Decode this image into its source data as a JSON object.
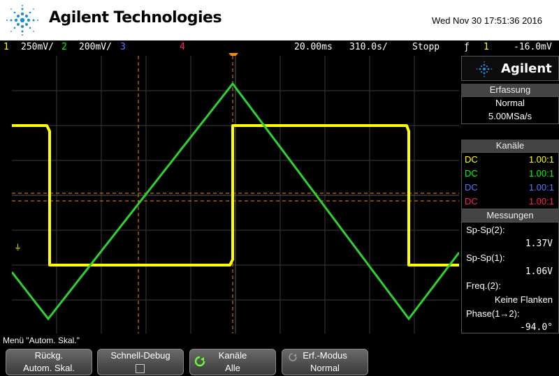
{
  "header": {
    "brand": "Agilent Technologies",
    "datetime": "Wed Nov 30 17:51:36 2016"
  },
  "status": {
    "ch1_num": "1",
    "ch1_scale": "250mV/",
    "ch2_num": "2",
    "ch2_scale": "200mV/",
    "ch3_num": "3",
    "ch4_num": "4",
    "timebase": "20.00ms",
    "delay": "310.0s/",
    "run_state": "Stopp",
    "trigger_symbol": "ƒ",
    "trigger_channel": "1",
    "trigger_level": "-16.0mV",
    "colors": {
      "ch1": "#ffff00",
      "ch2": "#00ff00",
      "ch3": "#5577ff",
      "ch4": "#ff2255"
    }
  },
  "panel": {
    "brand": "Agilent",
    "acquisition": {
      "title": "Erfassung",
      "mode": "Normal",
      "rate": "5.00MSa/s"
    },
    "channels": {
      "title": "Kanäle",
      "rows": [
        {
          "coupling": "DC",
          "ratio": "1.00:1",
          "color": "#ffff00"
        },
        {
          "coupling": "DC",
          "ratio": "1.00:1",
          "color": "#00ff00"
        },
        {
          "coupling": "DC",
          "ratio": "1.00:1",
          "color": "#5577ff"
        },
        {
          "coupling": "DC",
          "ratio": "1.00:1",
          "color": "#ff2255"
        }
      ]
    },
    "measurements": {
      "title": "Messungen",
      "items": [
        {
          "label": "Sp-Sp(2):",
          "value": "1.37V"
        },
        {
          "label": "Sp-Sp(1):",
          "value": "1.06V"
        },
        {
          "label": "Freq.(2):",
          "value": "Keine Flanken"
        },
        {
          "label": "Phase(1→2):",
          "value": "-94.0°"
        }
      ]
    }
  },
  "menu": {
    "title": "Menü \"Autom. Skal.\"",
    "softkeys": [
      {
        "line1": "Rückg.",
        "line2": "Autom. Skal."
      },
      {
        "line1": "Schnell-Debug",
        "line2": ""
      },
      {
        "line1": "Kanäle",
        "line2": "Alle"
      },
      {
        "line1": "Erf.-Modus",
        "line2": "Normal"
      }
    ]
  }
}
